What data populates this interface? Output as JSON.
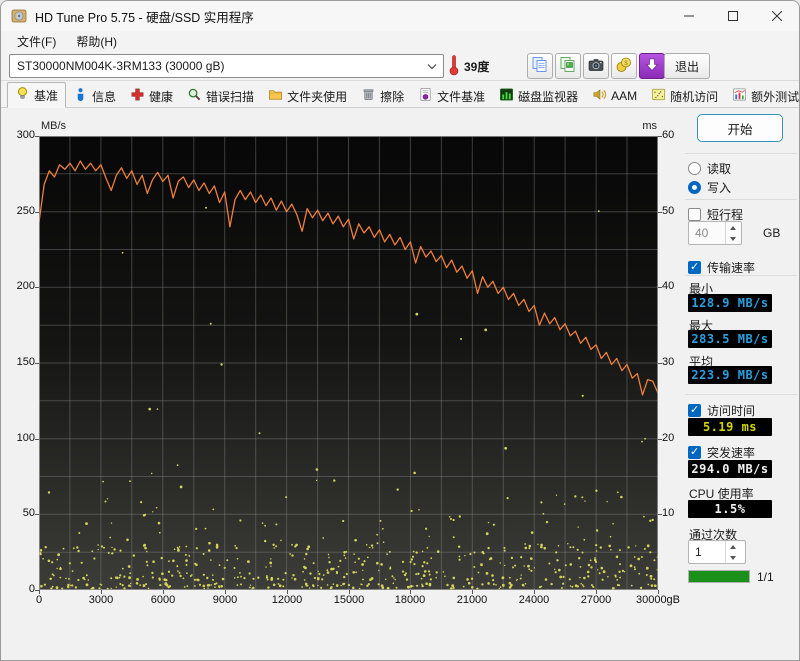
{
  "window": {
    "title": "HD Tune Pro 5.75 - 硬盘/SSD 实用程序"
  },
  "menu": {
    "items": [
      {
        "label": "文件(F)"
      },
      {
        "label": "帮助(H)"
      }
    ]
  },
  "toolbar": {
    "drive_select": "ST30000NM004K-3RM133 (30000 gB)",
    "temperature": "39度",
    "buttons": [
      {
        "name": "copy-text"
      },
      {
        "name": "copy-image"
      },
      {
        "name": "screenshot"
      },
      {
        "name": "save"
      },
      {
        "name": "download"
      }
    ],
    "exit_label": "退出"
  },
  "tabs": [
    {
      "label": "基准",
      "icon": "benchmark",
      "active": true
    },
    {
      "label": "信息",
      "icon": "info",
      "active": false
    },
    {
      "label": "健康",
      "icon": "health",
      "active": false
    },
    {
      "label": "错误扫描",
      "icon": "scan",
      "active": false
    },
    {
      "label": "文件夹使用",
      "icon": "folder",
      "active": false
    },
    {
      "label": "擦除",
      "icon": "erase",
      "active": false
    },
    {
      "label": "文件基准",
      "icon": "filebench",
      "active": false
    },
    {
      "label": "磁盘监视器",
      "icon": "monitor",
      "active": false
    },
    {
      "label": "AAM",
      "icon": "aam",
      "active": false
    },
    {
      "label": "随机访问",
      "icon": "random",
      "active": false
    },
    {
      "label": "额外测试",
      "icon": "extra",
      "active": false
    }
  ],
  "sidebar": {
    "start_label": "开始",
    "read_label": "读取",
    "read_selected": false,
    "write_label": "写入",
    "write_selected": true,
    "short_stroke_label": "短行程",
    "short_stroke_checked": false,
    "short_stroke_value": "40",
    "short_stroke_unit": "GB",
    "transfer_label": "传输速率",
    "transfer_checked": true,
    "min_label": "最小",
    "min_value": "128.9 MB/s",
    "max_label": "最大",
    "max_value": "283.5 MB/s",
    "avg_label": "平均",
    "avg_value": "223.9 MB/s",
    "access_label": "访问时间",
    "access_checked": true,
    "access_value": "5.19 ms",
    "burst_label": "突发速率",
    "burst_checked": true,
    "burst_value": "294.0 MB/s",
    "cpu_label": "CPU 使用率",
    "cpu_value": "1.5%",
    "pass_label": "通过次数",
    "pass_value": "1",
    "progress_percent": 100,
    "progress_label": "1/1"
  },
  "chart_data": {
    "type": "line",
    "title": "",
    "grid": true,
    "left_axis": {
      "label": "MB/s",
      "min": 0,
      "max": 300,
      "ticks": [
        300,
        250,
        200,
        150,
        100,
        50,
        0
      ]
    },
    "right_axis": {
      "label": "ms",
      "min": 0,
      "max": 60,
      "ticks": [
        60,
        50,
        40,
        30,
        20,
        10
      ]
    },
    "x_axis": {
      "min": 0,
      "max": 30000,
      "tick_step": 3000,
      "tick_labels": [
        "0",
        "3000",
        "6000",
        "9000",
        "12000",
        "15000",
        "18000",
        "21000",
        "24000",
        "27000",
        "30000gB"
      ]
    },
    "transfer_rate": {
      "name": "写入传输速率",
      "color": "#ee7f3c",
      "x_step": 250,
      "values": [
        243,
        268,
        277,
        273,
        281,
        278,
        282,
        277,
        283.5,
        278,
        282,
        277,
        281,
        272,
        264,
        274,
        279,
        272,
        277,
        268,
        274,
        262,
        271,
        276,
        270,
        274,
        259,
        270,
        273,
        266,
        271,
        264,
        269,
        262,
        267,
        256,
        263,
        240,
        258,
        264,
        258,
        263,
        256,
        261,
        254,
        259,
        251,
        257,
        250,
        255,
        248,
        237,
        252,
        246,
        251,
        244,
        249,
        242,
        247,
        240,
        245,
        232,
        242,
        236,
        240,
        233,
        238,
        230,
        235,
        228,
        233,
        225,
        230,
        216,
        227,
        220,
        224,
        217,
        221,
        213,
        218,
        210,
        214,
        206,
        211,
        196,
        207,
        200,
        204,
        196,
        200,
        192,
        196,
        188,
        192,
        184,
        188,
        175,
        183,
        176,
        180,
        172,
        176,
        168,
        171,
        163,
        167,
        159,
        162,
        153,
        157,
        149,
        153,
        145,
        149,
        140,
        143,
        128.9,
        139,
        138,
        130
      ]
    },
    "access_time_scatter": {
      "name": "访问时间",
      "color": "#d4d45a",
      "seed": 42,
      "bands": [
        {
          "count": 160,
          "ms_min": 0.15,
          "ms_max": 0.9,
          "exponent": 1
        },
        {
          "count": 340,
          "ms_min": 1.3,
          "ms_max": 6.0,
          "exponent": 1.6
        },
        {
          "count": 90,
          "ms_min": 5.5,
          "ms_max": 13,
          "exponent": 1.8
        },
        {
          "count": 26,
          "ms_min": 13,
          "ms_max": 57,
          "exponent": 1.7
        }
      ]
    },
    "colors": {
      "plot_bg_top": "#070707",
      "plot_bg_bottom": "#3c3c38",
      "grid": "#808080"
    }
  }
}
